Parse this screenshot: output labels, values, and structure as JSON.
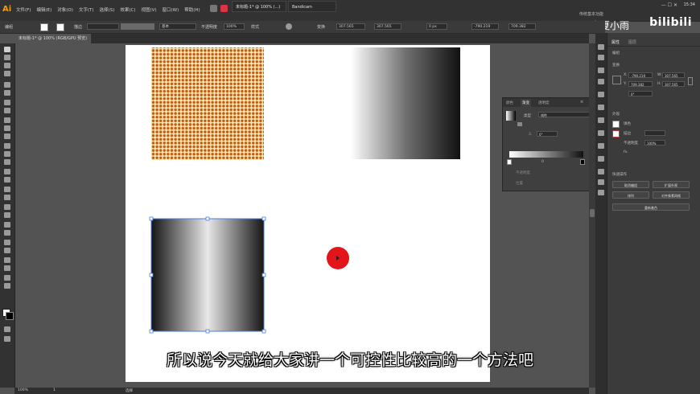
{
  "app": {
    "logo": "Ai"
  },
  "menu": [
    "文件(F)",
    "编辑(E)",
    "对象(O)",
    "文字(T)",
    "选择(S)",
    "效果(C)",
    "视图(V)",
    "窗口(W)",
    "帮助(H)"
  ],
  "window_tabs": [
    "未标题-1* @ 100% (...)",
    "Bandicam"
  ],
  "workspace_label": "传统基本功能",
  "clock": "15:34",
  "watermark": {
    "user": "米夏小雨",
    "logo": "bilibili"
  },
  "control_bar": {
    "mode": "编组",
    "stroke_label": "描边",
    "line_style": "基本",
    "opacity_label": "不透明度",
    "opacity": "100%",
    "style_label": "样式",
    "transform_label": "变换",
    "x": "307.565",
    "w": "307.565",
    "y": "-790.219",
    "h": "709.382",
    "rot": "0 px"
  },
  "document_tab": "未标题-1* @ 100% (RGB/GPU 预览)",
  "status_bar": {
    "zoom": "100%",
    "page": "1",
    "mode": "选择"
  },
  "gradient_panel": {
    "tabs": [
      "颜色",
      "渐变",
      "透明度"
    ],
    "type_label": "类型",
    "type_value": "线性",
    "angle": "0°",
    "stop_value": "0",
    "opacity_label": "不透明度",
    "location_label": "位置"
  },
  "properties_panel": {
    "tabs": [
      "属性",
      "图层"
    ],
    "section_group": "编组",
    "transform_label": "变换",
    "x": "-790.219",
    "y": "709.382",
    "w": "307.565",
    "h": "307.565",
    "angle": "0°",
    "appearance_label": "外观",
    "fill_label": "填色",
    "stroke_label": "描边",
    "opacity_label": "不透明度",
    "opacity_value": "100%",
    "fx_label": "fx.",
    "quick_actions_label": "快速操作",
    "buttons": [
      "取消编组",
      "扩展外观",
      "排列",
      "对齐像素网格",
      "重新着色"
    ]
  },
  "subtitle": "所以说今天就给大家讲一个可控性比较高的一个方法吧",
  "colors": {
    "accent": "#ff9a00",
    "halftone_orange": "#c35a0b",
    "cursor_dot": "#e4141b"
  }
}
